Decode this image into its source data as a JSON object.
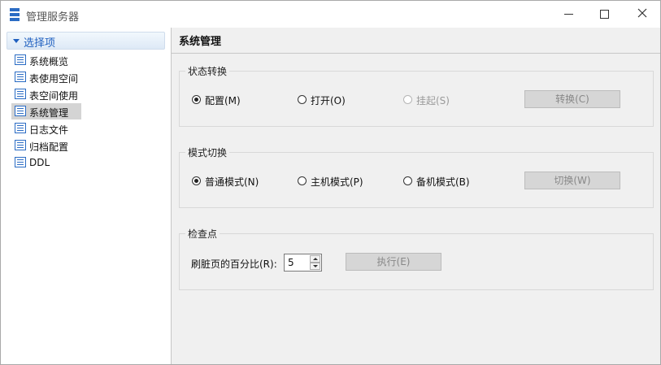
{
  "window": {
    "title": "管理服务器"
  },
  "sidebar": {
    "section_label": "选择项",
    "items": [
      {
        "label": "系统概览",
        "selected": false
      },
      {
        "label": "表使用空间",
        "selected": false
      },
      {
        "label": "表空间使用",
        "selected": false
      },
      {
        "label": "系统管理",
        "selected": true
      },
      {
        "label": "日志文件",
        "selected": false
      },
      {
        "label": "归档配置",
        "selected": false
      },
      {
        "label": "DDL",
        "selected": false
      }
    ]
  },
  "main": {
    "title": "系统管理",
    "state_group": {
      "title": "状态转换",
      "options": [
        {
          "label": "配置(M)",
          "checked": true,
          "disabled": false
        },
        {
          "label": "打开(O)",
          "checked": false,
          "disabled": false
        },
        {
          "label": "挂起(S)",
          "checked": false,
          "disabled": true
        }
      ],
      "button": "转换(C)"
    },
    "mode_group": {
      "title": "模式切换",
      "options": [
        {
          "label": "普通模式(N)",
          "checked": true,
          "disabled": false
        },
        {
          "label": "主机模式(P)",
          "checked": false,
          "disabled": false
        },
        {
          "label": "备机模式(B)",
          "checked": false,
          "disabled": false
        }
      ],
      "button": "切换(W)"
    },
    "checkpoint_group": {
      "title": "检查点",
      "field_label": "刷脏页的百分比(R):",
      "field_value": "5",
      "button": "执行(E)"
    }
  },
  "colors": {
    "accent": "#1f5fbf",
    "icon_blue": "#2b6cc4",
    "panel_bg": "#f0f0f0",
    "selected_bg": "#d4d4d4"
  }
}
